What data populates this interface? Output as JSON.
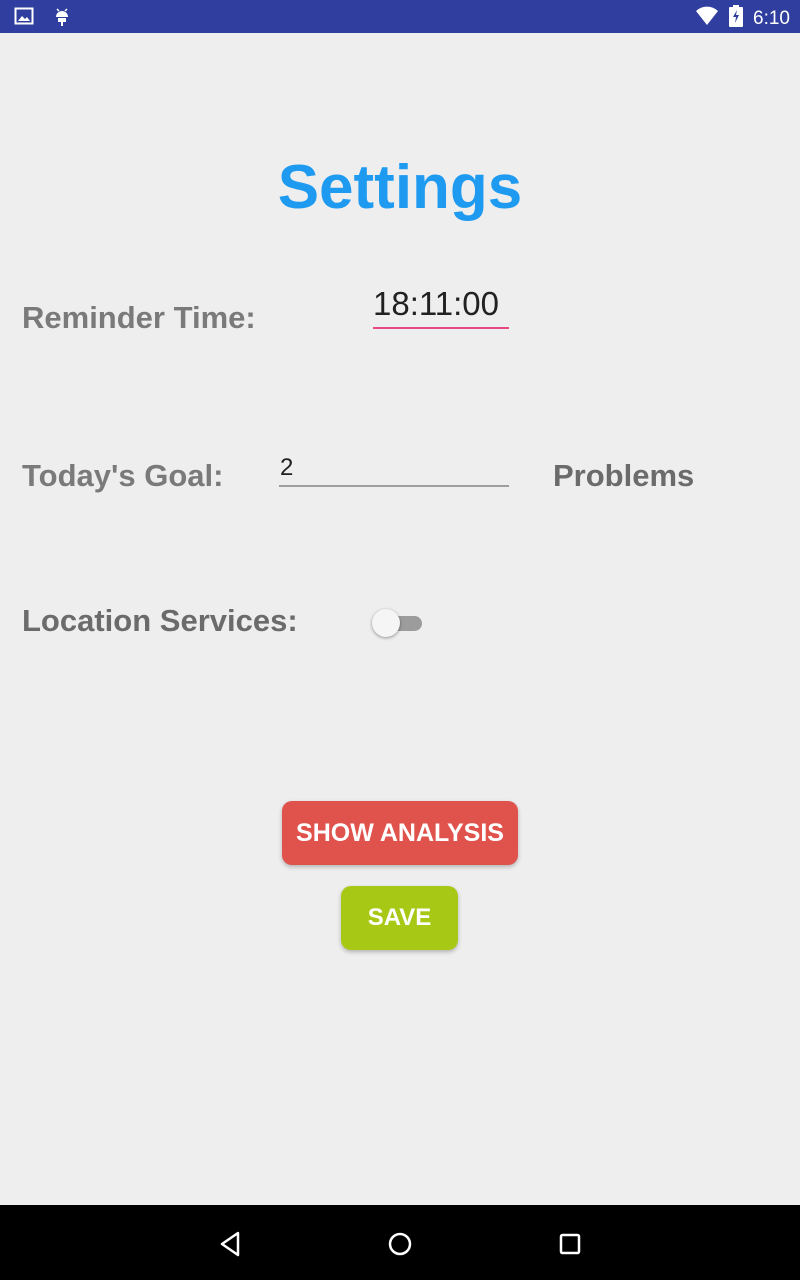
{
  "status_bar": {
    "time": "6:10",
    "icons_left": [
      "image-icon",
      "android-icon"
    ],
    "icons_right": [
      "wifi-icon",
      "battery-charging-icon"
    ],
    "background": "#303f9f"
  },
  "page": {
    "title": "Settings",
    "title_color": "#1e9bf0"
  },
  "reminder": {
    "label": "Reminder Time:",
    "value": "18:11:00"
  },
  "goal": {
    "label": "Today's Goal:",
    "value": "2",
    "unit": "Problems"
  },
  "location": {
    "label": "Location Services:",
    "enabled": false
  },
  "buttons": {
    "analysis_label": "SHOW ANALYSIS",
    "analysis_color": "#e0524c",
    "save_label": "SAVE",
    "save_color": "#a8c816"
  },
  "nav_bar": {
    "items": [
      "back-icon",
      "home-icon",
      "recents-icon"
    ]
  }
}
